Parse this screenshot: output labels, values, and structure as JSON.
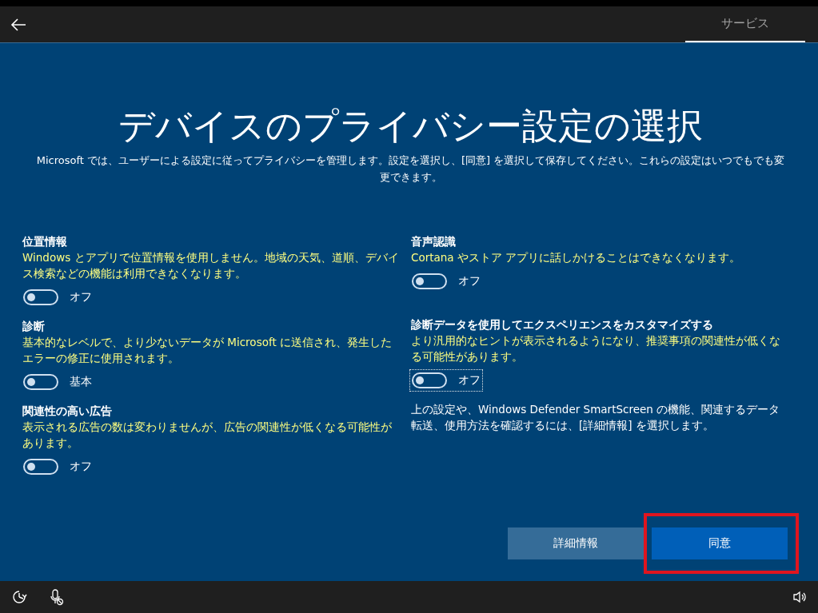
{
  "top_bar": {
    "tabs": [
      {
        "label": "サービス",
        "selected": true
      }
    ]
  },
  "title": "デバイスのプライバシー設定の選択",
  "intro": "Microsoft では、ユーザーによる設定に従ってプライバシーを管理します。設定を選択し、[同意] を選択して保存してください。これらの設定はいつでもでも変更できます。",
  "left_settings": [
    {
      "title": "位置情報",
      "description": "Windows とアプリで位置情報を使用しません。地域の天気、道順、デバイス検索などの機能は利用できなくなります。",
      "on": false,
      "state_label": "オフ",
      "focused": false
    },
    {
      "title": "診断",
      "description": "基本的なレベルで、より少ないデータが Microsoft に送信され、発生したエラーの修正に使用されます。",
      "on": false,
      "state_label": "基本",
      "focused": false
    },
    {
      "title": "関連性の高い広告",
      "description": "表示される広告の数は変わりませんが、広告の関連性が低くなる可能性があります。",
      "on": false,
      "state_label": "オフ",
      "focused": false
    }
  ],
  "right_settings": [
    {
      "title": "音声認識",
      "description": "Cortana やストア アプリに話しかけることはできなくなります。",
      "on": false,
      "state_label": "オフ",
      "focused": false
    },
    {
      "title": "診断データを使用してエクスペリエンスをカスタマイズする",
      "description": "より汎用的なヒントが表示されるようになり、推奨事項の関連性が低くなる可能性があります。",
      "on": false,
      "state_label": "オフ",
      "focused": true
    }
  ],
  "note": "上の設定や、Windows Defender SmartScreen の機能、関連するデータ転送、使用方法を確認するには、[詳細情報] を選択します。",
  "buttons": [
    {
      "label": "詳細情報",
      "kind": "secondary",
      "highlighted": false
    },
    {
      "label": "同意",
      "kind": "primary",
      "highlighted": true
    }
  ]
}
